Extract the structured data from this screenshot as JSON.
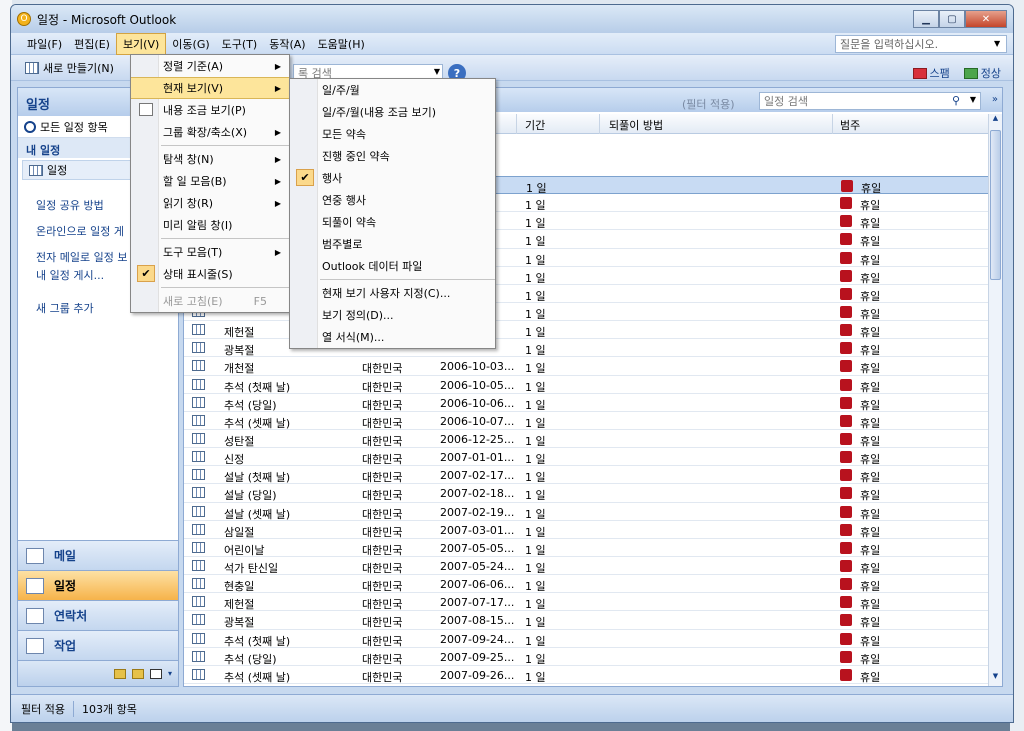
{
  "window": {
    "title": "일정 - Microsoft Outlook"
  },
  "menubar": {
    "items": [
      "파일(F)",
      "편집(E)",
      "보기(V)",
      "이동(G)",
      "도구(T)",
      "동작(A)",
      "도움말(H)"
    ],
    "help_placeholder": "질문을 입력하십시오."
  },
  "toolbar": {
    "new_label": "새로 만들기(N)",
    "search_placeholder": "록 검색",
    "junk_label": "스팸",
    "safe_label": "정상"
  },
  "nav": {
    "header": "일정",
    "all_items": "모든 일정 항목",
    "my_calendars": "내 일정",
    "calendar": "일정",
    "links": [
      "일정 공유 방법",
      "온라인으로 일정 게",
      "전자 메일로 일정 보",
      "내 일정 게시...",
      "새 그룹 추가"
    ],
    "buttons": [
      "메일",
      "일정",
      "연락처",
      "작업"
    ]
  },
  "main": {
    "filter_label": "(필터 적용)",
    "search_placeholder": "일정 검색",
    "columns": [
      "기간",
      "되풀이 방법",
      "범주"
    ],
    "rows": [
      {
        "subject": "",
        "location": "",
        "start": "",
        "duration": "1 일",
        "category": "휴일",
        "selected": true
      },
      {
        "subject": "",
        "location": "",
        "start": "",
        "duration": "1 일",
        "category": "휴일"
      },
      {
        "subject": "",
        "location": "",
        "start": "",
        "duration": "1 일",
        "category": "휴일"
      },
      {
        "subject": "",
        "location": "",
        "start": "",
        "duration": "1 일",
        "category": "휴일"
      },
      {
        "subject": "",
        "location": "",
        "start": "",
        "duration": "1 일",
        "category": "휴일"
      },
      {
        "subject": "",
        "location": "",
        "start": "",
        "duration": "1 일",
        "category": "휴일"
      },
      {
        "subject": "",
        "location": "",
        "start": "",
        "duration": "1 일",
        "category": "휴일"
      },
      {
        "subject": "",
        "location": "",
        "start": "",
        "duration": "1 일",
        "category": "휴일"
      },
      {
        "subject": "제헌절",
        "location": "",
        "start": "",
        "duration": "1 일",
        "category": "휴일"
      },
      {
        "subject": "광복절",
        "location": "",
        "start": "",
        "duration": "1 일",
        "category": "휴일"
      },
      {
        "subject": "개천절",
        "location": "대한민국",
        "start": "2006-10-03...",
        "duration": "1 일",
        "category": "휴일"
      },
      {
        "subject": "추석 (첫째 날)",
        "location": "대한민국",
        "start": "2006-10-05...",
        "duration": "1 일",
        "category": "휴일"
      },
      {
        "subject": "추석 (당일)",
        "location": "대한민국",
        "start": "2006-10-06...",
        "duration": "1 일",
        "category": "휴일"
      },
      {
        "subject": "추석 (셋째 날)",
        "location": "대한민국",
        "start": "2006-10-07...",
        "duration": "1 일",
        "category": "휴일"
      },
      {
        "subject": "성탄절",
        "location": "대한민국",
        "start": "2006-12-25...",
        "duration": "1 일",
        "category": "휴일"
      },
      {
        "subject": "신정",
        "location": "대한민국",
        "start": "2007-01-01...",
        "duration": "1 일",
        "category": "휴일"
      },
      {
        "subject": "설날 (첫째 날)",
        "location": "대한민국",
        "start": "2007-02-17...",
        "duration": "1 일",
        "category": "휴일"
      },
      {
        "subject": "설날 (당일)",
        "location": "대한민국",
        "start": "2007-02-18...",
        "duration": "1 일",
        "category": "휴일"
      },
      {
        "subject": "설날 (셋째 날)",
        "location": "대한민국",
        "start": "2007-02-19...",
        "duration": "1 일",
        "category": "휴일"
      },
      {
        "subject": "삼일절",
        "location": "대한민국",
        "start": "2007-03-01...",
        "duration": "1 일",
        "category": "휴일"
      },
      {
        "subject": "어린이날",
        "location": "대한민국",
        "start": "2007-05-05...",
        "duration": "1 일",
        "category": "휴일"
      },
      {
        "subject": "석가 탄신일",
        "location": "대한민국",
        "start": "2007-05-24...",
        "duration": "1 일",
        "category": "휴일"
      },
      {
        "subject": "현충일",
        "location": "대한민국",
        "start": "2007-06-06...",
        "duration": "1 일",
        "category": "휴일"
      },
      {
        "subject": "제헌절",
        "location": "대한민국",
        "start": "2007-07-17...",
        "duration": "1 일",
        "category": "휴일"
      },
      {
        "subject": "광복절",
        "location": "대한민국",
        "start": "2007-08-15...",
        "duration": "1 일",
        "category": "휴일"
      },
      {
        "subject": "추석 (첫째 날)",
        "location": "대한민국",
        "start": "2007-09-24...",
        "duration": "1 일",
        "category": "휴일"
      },
      {
        "subject": "추석 (당일)",
        "location": "대한민국",
        "start": "2007-09-25...",
        "duration": "1 일",
        "category": "휴일"
      },
      {
        "subject": "추석 (셋째 날)",
        "location": "대한민국",
        "start": "2007-09-26...",
        "duration": "1 일",
        "category": "휴일"
      }
    ]
  },
  "view_menu": {
    "items": [
      {
        "label": "정렬 기준(A)",
        "submenu": true
      },
      {
        "label": "현재 보기(V)",
        "submenu": true,
        "highlighted": true
      },
      {
        "label": "내용 조금 보기(P)",
        "icon": true
      },
      {
        "label": "그룹 확장/축소(X)",
        "submenu": true
      },
      {
        "sep": true
      },
      {
        "label": "탐색 창(N)",
        "submenu": true
      },
      {
        "label": "할 일 모음(B)",
        "submenu": true
      },
      {
        "label": "읽기 창(R)",
        "submenu": true
      },
      {
        "label": "미리 알림 창(I)"
      },
      {
        "sep": true
      },
      {
        "label": "도구 모음(T)",
        "submenu": true
      },
      {
        "label": "상태 표시줄(S)",
        "checked": true
      },
      {
        "sep": true
      },
      {
        "label": "새로 고침(E)",
        "shortcut": "F5",
        "disabled": true
      }
    ]
  },
  "current_view_menu": {
    "items": [
      {
        "label": "일/주/월"
      },
      {
        "label": "일/주/월(내용 조금 보기)"
      },
      {
        "label": "모든 약속"
      },
      {
        "label": "진행 중인 약속"
      },
      {
        "label": "행사",
        "checked": true
      },
      {
        "label": "연중 행사"
      },
      {
        "label": "되풀이 약속"
      },
      {
        "label": "범주별로"
      },
      {
        "label": "Outlook 데이터 파일"
      },
      {
        "sep": true
      },
      {
        "label": "현재 보기 사용자 지정(C)..."
      },
      {
        "label": "보기 정의(D)..."
      },
      {
        "label": "열 서식(M)..."
      }
    ]
  },
  "status": {
    "filter": "필터 적용",
    "count": "103개 항목"
  }
}
